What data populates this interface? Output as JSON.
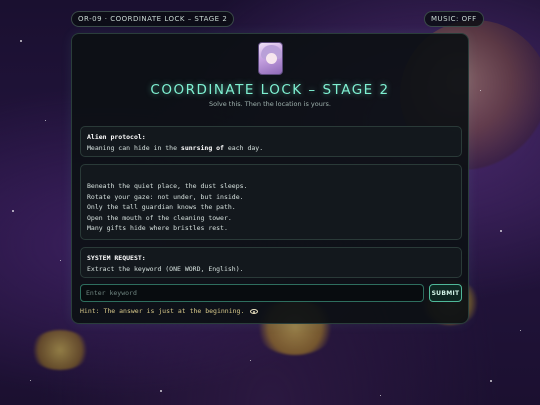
{
  "header": {
    "level_code": "OR-09 · COORDINATE LOCK – STAGE 2",
    "music_toggle": "MUSIC: OFF"
  },
  "title": "COORDINATE LOCK – STAGE 2",
  "subtitle": "Solve this. Then the location is yours.",
  "alien_protocol": {
    "label": "Alien protocol:",
    "text_before": "Meaning can hide in the ",
    "emphasis": "sunrsing of",
    "text_after": " each day."
  },
  "riddle": {
    "lines": [
      "Beneath the quiet place, the dust sleeps.",
      "Rotate your gaze: not under, but inside.",
      "Only the tall guardian knows the path.",
      "Open the mouth of the cleaning tower.",
      "Many gifts hide where bristles rest."
    ]
  },
  "system_request": {
    "label": "SYSTEM REQUEST:",
    "text": "Extract the keyword (ONE WORD, English)."
  },
  "input": {
    "placeholder": "Enter keyword",
    "value": ""
  },
  "submit_label": "SUBMIT",
  "hint": "Hint: The answer is just at the beginning."
}
